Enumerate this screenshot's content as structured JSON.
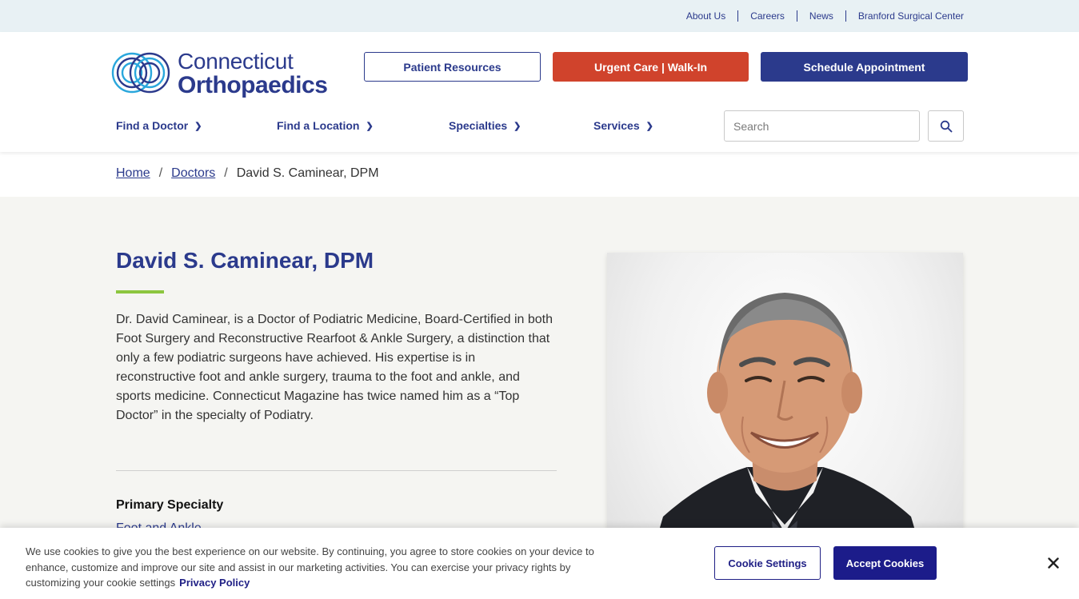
{
  "utility_nav": {
    "items": [
      "About Us",
      "Careers",
      "News",
      "Branford Surgical Center"
    ]
  },
  "header": {
    "logo_line1": "Connecticut",
    "logo_line2": "Orthopaedics",
    "patient_resources": "Patient Resources",
    "urgent_care": "Urgent Care | Walk-In",
    "schedule": "Schedule Appointment",
    "nav": {
      "find_doctor": "Find a Doctor",
      "find_location": "Find a Location",
      "specialties": "Specialties",
      "services": "Services"
    },
    "search_placeholder": "Search"
  },
  "breadcrumb": {
    "home": "Home",
    "doctors": "Doctors",
    "current": "David S. Caminear, DPM",
    "separator": "/"
  },
  "doctor": {
    "name": "David S. Caminear, DPM",
    "bio": "Dr. David Caminear, is a Doctor of Podiatric Medicine, Board-Certified in both Foot Surgery and Reconstructive Rearfoot & Ankle Surgery, a distinction that only a few podiatric surgeons have achieved. His expertise is in reconstructive foot and ankle surgery, trauma to the foot and ankle, and sports medicine. Connecticut Magazine has twice named him as a “Top Doctor” in the specialty of Podiatry.",
    "primary_specialty_label": "Primary Specialty",
    "primary_specialty_value": "Foot and Ankle"
  },
  "cookie_banner": {
    "text": "We use cookies to give you the best experience on our website. By continuing, you agree to store cookies on your device to enhance, customize and improve our site and assist in our marketing activities. You can exercise your privacy rights by customizing your cookie settings",
    "privacy_link": "Privacy Policy",
    "settings_button": "Cookie Settings",
    "accept_button": "Accept Cookies"
  },
  "colors": {
    "brand_blue": "#2b3a8c",
    "urgent_red": "#d0432c",
    "accent_green": "#8cc63f",
    "cookie_navy": "#1c1c8a"
  },
  "icons": [
    "search-icon",
    "chevron-right-icon",
    "close-icon",
    "logo-mark-icon"
  ]
}
